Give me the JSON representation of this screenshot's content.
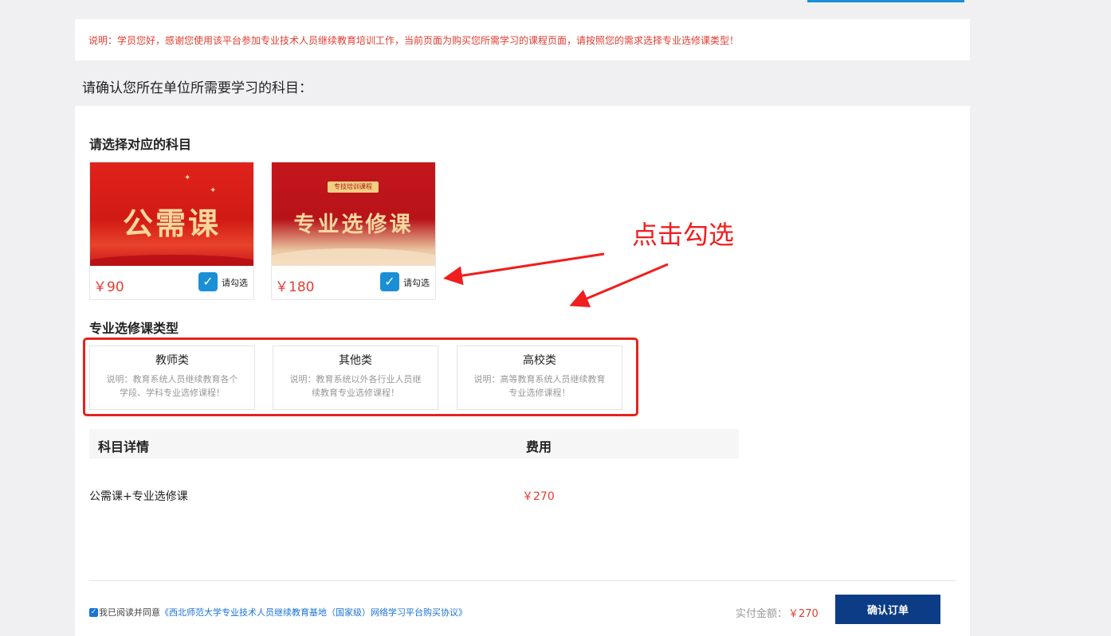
{
  "notice": "说明：学员您好，感谢您使用该平台参加专业技术人员继续教育培训工作，当前页面为购买您所需学习的课程页面，请按照您的需求选择专业选修课类型！",
  "confirm_heading": "请确认您所在单位所需要学习的科目：",
  "subject_section": {
    "title": "请选择对应的科目",
    "courses": [
      {
        "image_text": "公需课",
        "price": "￥90",
        "check_label": "请勾选",
        "checked": true
      },
      {
        "image_tag": "专技培训课程",
        "image_text": "专业选修课",
        "price": "￥180",
        "check_label": "请勾选",
        "checked": true
      }
    ]
  },
  "annotation": {
    "text": "点击勾选",
    "color": "#f01e1e"
  },
  "type_section": {
    "title": "专业选修课类型",
    "types": [
      {
        "name": "教师类",
        "desc": "说明：教育系统人员继续教育各个学段、学科专业选修课程！"
      },
      {
        "name": "其他类",
        "desc": "说明：教育系统以外各行业人员继续教育专业选修课程！"
      },
      {
        "name": "高校类",
        "desc": "说明：高等教育系统人员继续教育专业选修课程！"
      }
    ]
  },
  "table": {
    "header_subject": "科目详情",
    "header_fee": "费用",
    "row_subject": "公需课+专业选修课",
    "row_fee": "￥270"
  },
  "footer": {
    "agree_text": "我已阅读并同意",
    "agree_link": "《西北师范大学专业技术人员继续教育基地（国家级）网络学习平台购买协议》",
    "amount_label": "实付金额：",
    "amount_value": "￥270",
    "confirm_button": "确认订单"
  },
  "colors": {
    "accent": "#1a8fd6",
    "price": "#e23d31",
    "button": "#0c3c86"
  }
}
